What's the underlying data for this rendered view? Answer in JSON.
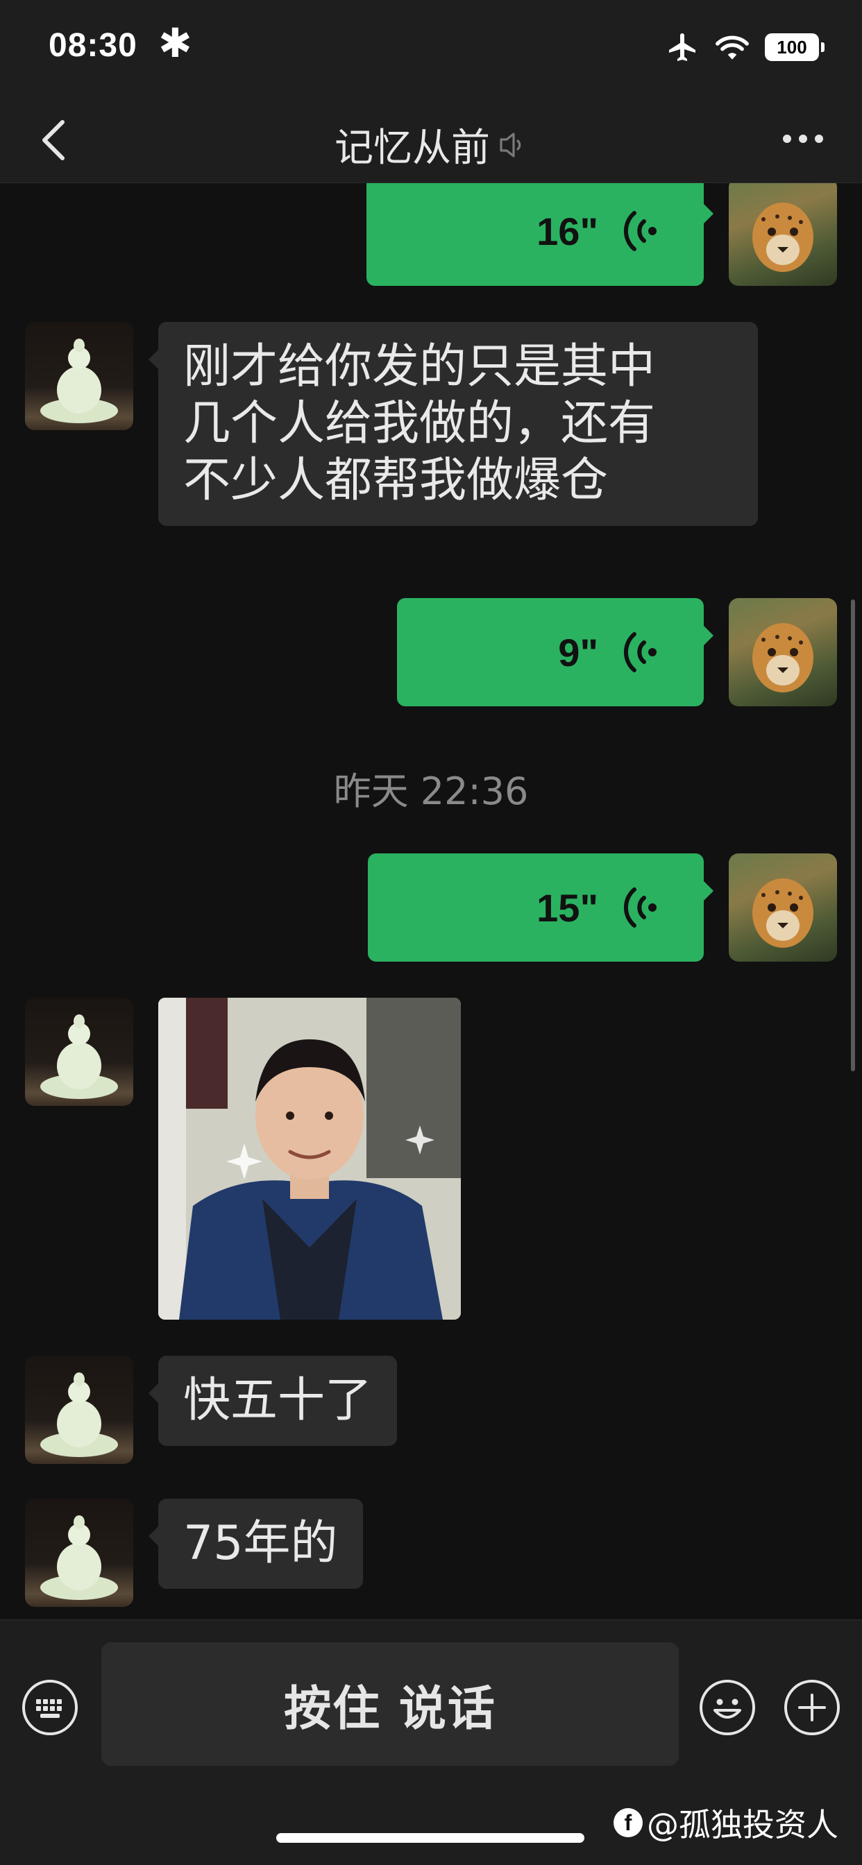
{
  "status_bar": {
    "time": "08:30",
    "extra_symbol": "✱",
    "battery": "100"
  },
  "nav": {
    "title": "记忆从前",
    "icons": {
      "back": "chevron-left-icon",
      "mute": "muted-speaker-icon",
      "more": "more-dots-icon"
    }
  },
  "messages": [
    {
      "type": "voice",
      "direction": "out",
      "duration": "16\""
    },
    {
      "type": "text",
      "direction": "in",
      "lines": [
        "刚才给你发的只是其中",
        "几个人给我做的，还有",
        "不少人都帮我做爆仓"
      ]
    },
    {
      "type": "voice",
      "direction": "out",
      "duration": "9\""
    },
    {
      "type": "timestamp",
      "text": "昨天 22:36"
    },
    {
      "type": "voice",
      "direction": "out",
      "duration": "15\""
    },
    {
      "type": "image",
      "direction": "in",
      "description": "photo-of-man"
    },
    {
      "type": "text",
      "direction": "in",
      "text": "快五十了"
    },
    {
      "type": "text",
      "direction": "in",
      "text": "75年的"
    }
  ],
  "input_bar": {
    "hold_to_talk": "按住 说话",
    "icons": {
      "keyboard": "keyboard-icon",
      "emoji": "emoji-icon",
      "plus": "plus-icon"
    }
  },
  "watermark": "@孤独投资人",
  "colors": {
    "accent_green": "#2bb261",
    "incoming_bubble": "#2c2c2c",
    "background": "#111111",
    "bar": "#1e1e1e"
  }
}
